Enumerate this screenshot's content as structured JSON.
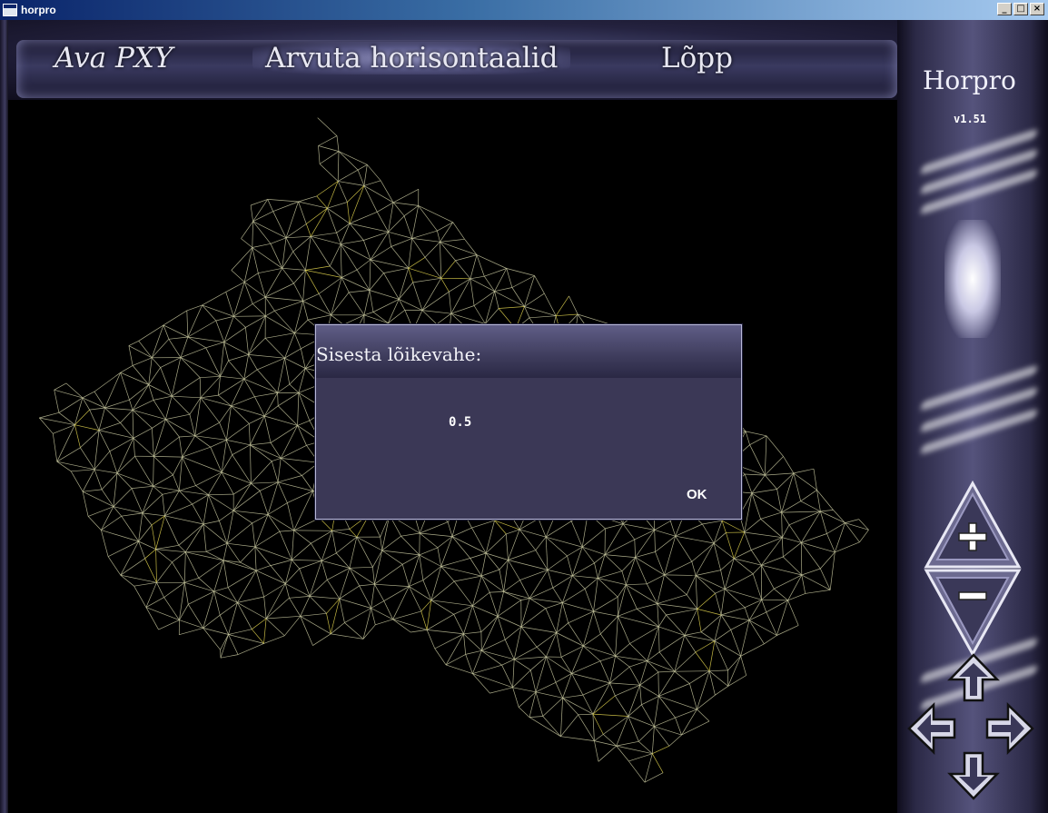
{
  "window": {
    "title": "horpro",
    "controls": {
      "minimize": "_",
      "maximize": "□",
      "close": "×"
    }
  },
  "menu": {
    "open_label": "Ava  PXY",
    "calculate_label": "Arvuta horisontaalid",
    "exit_label": "Lõpp"
  },
  "side_panel": {
    "brand": "Horpro",
    "version": "v1.51",
    "buttons": [
      "zoom-in",
      "zoom-out",
      "pan-up",
      "pan-left",
      "pan-right",
      "pan-down"
    ]
  },
  "dialog": {
    "title": "Sisesta lõikevahe:",
    "value": "0.5",
    "ok_label": "OK"
  },
  "colors": {
    "mesh_line": "#c8c8a0",
    "mesh_highlight": "#e6d850",
    "panel_base": "#3b3856",
    "canvas_bg": "#000000"
  }
}
